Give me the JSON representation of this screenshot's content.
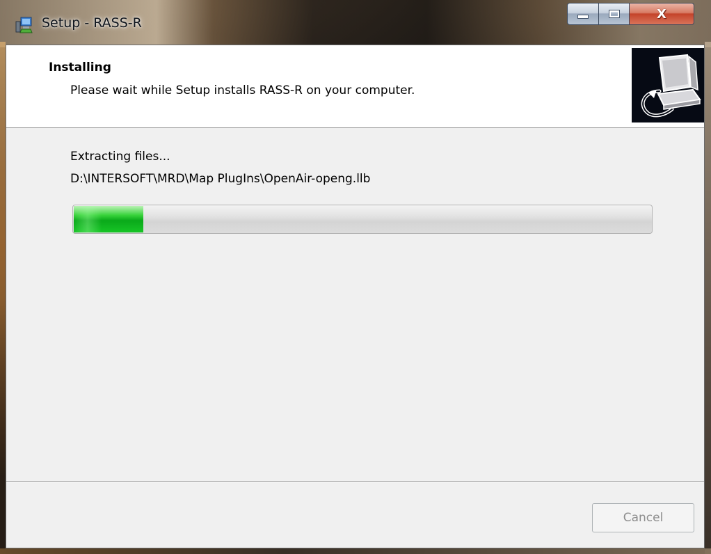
{
  "window": {
    "title": "Setup - RASS-R",
    "app_icon": "setup-installer-icon",
    "controls": {
      "minimize_icon": "minimize-icon",
      "maximize_icon": "maximize-icon",
      "close_label": "X"
    }
  },
  "header": {
    "title": "Installing",
    "subtitle": "Please wait while Setup installs RASS-R on your computer.",
    "image_icon": "computer-install-icon"
  },
  "progress": {
    "status": "Extracting files...",
    "current_file": "D:\\INTERSOFT\\MRD\\Map PlugIns\\OpenAir-openg.llb",
    "fraction": 0.12
  },
  "footer": {
    "cancel_label": "Cancel",
    "cancel_enabled": false
  },
  "colors": {
    "progress_green": "#17c526",
    "client_bg": "#f0f0f0",
    "header_bg": "#ffffff",
    "close_red": "#c4432a"
  }
}
